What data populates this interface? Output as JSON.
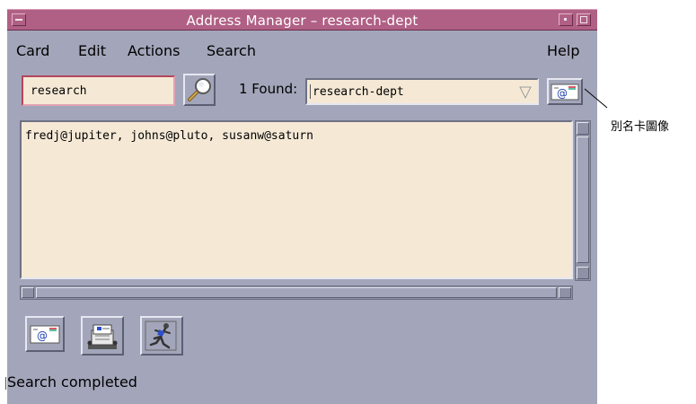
{
  "window": {
    "title": "Address Manager – research-dept"
  },
  "menubar": {
    "items": [
      "Card",
      "Edit",
      "Actions",
      "Search"
    ],
    "help": "Help"
  },
  "search": {
    "query": "research",
    "found_label": "1 Found:",
    "found_value": "research-dept"
  },
  "content": {
    "text": "fredj@jupiter, johns@pluto, susanw@saturn"
  },
  "toolbar": {
    "buttons": [
      "mail-card-icon",
      "rolodex-icon",
      "runner-icon"
    ]
  },
  "status": {
    "text": "Search completed"
  },
  "callout": {
    "text": "別名卡圖像"
  },
  "colors": {
    "titlebar": "#b06085",
    "window_bg": "#a3a6ba",
    "field_bg": "#f5e9d6"
  }
}
